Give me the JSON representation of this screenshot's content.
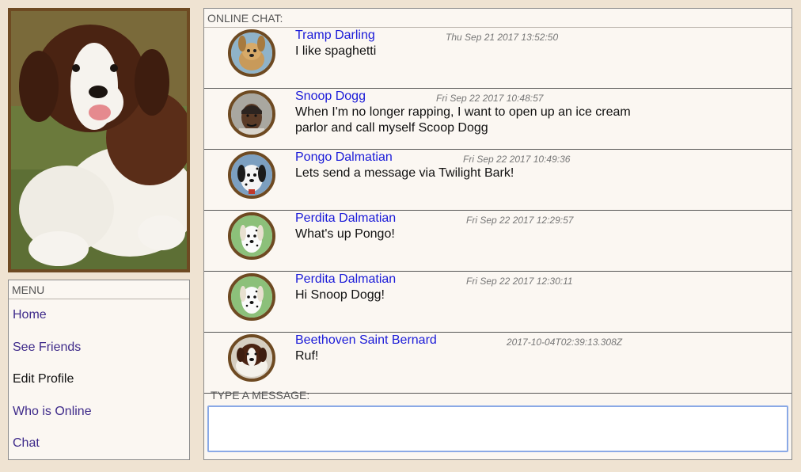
{
  "menu": {
    "title": "MENU",
    "items": [
      {
        "label": "Home"
      },
      {
        "label": "See Friends"
      },
      {
        "label": "Edit Profile"
      },
      {
        "label": "Who is Online"
      },
      {
        "label": "Chat"
      }
    ]
  },
  "chat": {
    "title": "ONLINE CHAT:",
    "messages": [
      {
        "name": "Tramp Darling",
        "time": "Thu Sep 21 2017 13:52:50",
        "text": "I like spaghetti"
      },
      {
        "name": "Snoop Dogg",
        "time": "Fri Sep 22 2017 10:48:57",
        "text": "When I'm no longer rapping, I want to open up an ice cream parlor and call myself Scoop Dogg"
      },
      {
        "name": "Pongo Dalmatian",
        "time": "Fri Sep 22 2017 10:49:36",
        "text": "Lets send a message via Twilight Bark!"
      },
      {
        "name": "Perdita Dalmatian",
        "time": "Fri Sep 22 2017 12:29:57",
        "text": "What's up Pongo!"
      },
      {
        "name": "Perdita Dalmatian",
        "time": "Fri Sep 22 2017 12:30:11",
        "text": "Hi Snoop Dogg!"
      },
      {
        "name": "Beethoven Saint Bernard",
        "time": "2017-10-04T02:39:13.308Z",
        "text": "Ruf!"
      }
    ],
    "input_label": "TYPE A MESSAGE:",
    "input_value": ""
  },
  "colors": {
    "page_background": "#efe3d2",
    "panel_background": "#fbf7f2",
    "avatar_border": "#6e4a22",
    "name_link": "#1a1ad8",
    "menu_link": "#3e2a8a"
  }
}
